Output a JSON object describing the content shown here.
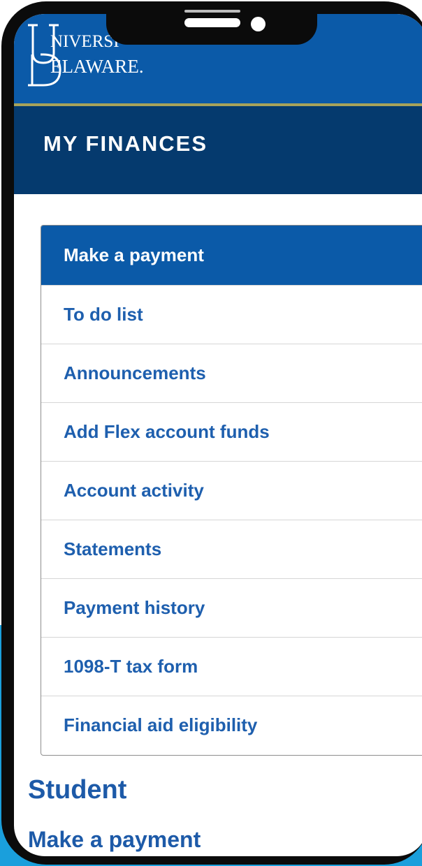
{
  "logo": {
    "line1": "NIVERSI",
    "line2": "ELAWARE."
  },
  "header": {
    "section_title": "MY FINANCES"
  },
  "menu": {
    "items": [
      {
        "label": "Make a payment",
        "active": true
      },
      {
        "label": "To do list"
      },
      {
        "label": "Announcements"
      },
      {
        "label": "Add Flex account funds"
      },
      {
        "label": "Account activity"
      },
      {
        "label": "Statements"
      },
      {
        "label": "Payment history"
      },
      {
        "label": "1098-T tax form"
      },
      {
        "label": "Financial aid eligibility"
      }
    ]
  },
  "content": {
    "heading": "Student",
    "link": "Make a payment"
  },
  "colors": {
    "brand_blue": "#0b5aa8",
    "header_navy": "#053a6e",
    "gold_rule": "#a7a35a",
    "link_blue": "#1e5fae",
    "backdrop_cyan": "#1a9fdc"
  }
}
